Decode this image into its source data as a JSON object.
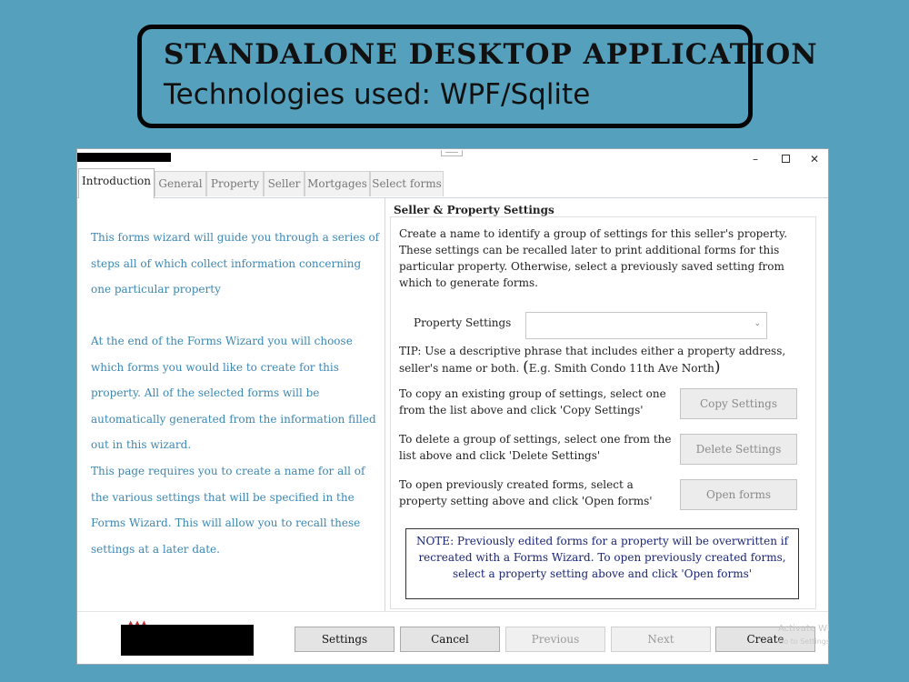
{
  "banner": {
    "title": "Standalone Desktop Application",
    "subtitle": "Technologies used: WPF/Sqlite"
  },
  "window": {
    "controls": {
      "minimize": "–",
      "close": "✕"
    }
  },
  "tabs": [
    {
      "label": "Introduction",
      "active": true
    },
    {
      "label": "General"
    },
    {
      "label": "Property"
    },
    {
      "label": "Seller"
    },
    {
      "label": "Mortgages"
    },
    {
      "label": "Select forms"
    }
  ],
  "intro": {
    "p1": "This forms wizard will guide you through a series of steps all of which collect information concerning one particular property",
    "p2": "At the end of the Forms Wizard you will choose which forms you would like to create for this property. All of the selected forms will be automatically generated from the information filled out in this wizard.",
    "p3": "This page requires you to create a name for all of the various settings that will be specified in the Forms Wizard. This will allow you to recall these settings at a later date."
  },
  "settings": {
    "heading": "Seller & Property Settings",
    "description": "Create a name to identify a group of settings for this seller's property. These settings can be recalled later to print additional forms for this particular property. Otherwise, select a previously saved setting from which to generate forms.",
    "property_label": "Property Settings",
    "property_value": "",
    "tip": "TIP: Use a descriptive phrase that includes either a property address, seller's name or both.",
    "tip_example": "E.g. Smith Condo 11th Ave North",
    "copy_text": "To copy an existing group of settings, select one from the list above and click 'Copy Settings'",
    "copy_button": "Copy Settings",
    "delete_text": "To delete a group of settings, select one from the list above and click 'Delete Settings'",
    "delete_button": "Delete Settings",
    "open_text": "To open previously created forms, select a property setting above and click 'Open forms'",
    "open_button": "Open forms",
    "note": "NOTE: Previously edited forms for a property will be overwritten if recreated with a Forms Wizard. To open previously created forms, select a property setting above and click 'Open forms'"
  },
  "footer": {
    "settings": "Settings",
    "cancel": "Cancel",
    "previous": "Previous",
    "next": "Next",
    "create": "Create",
    "watermark_line1": "Activate Wi",
    "watermark_line2": "Go to Settings t"
  }
}
